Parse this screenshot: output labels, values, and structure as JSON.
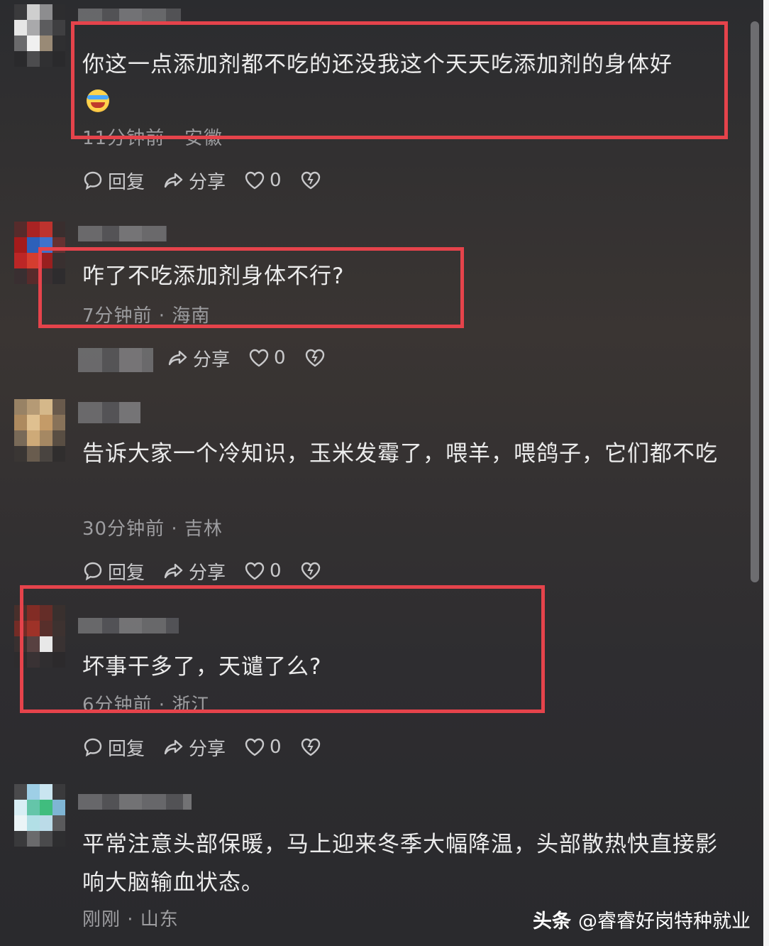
{
  "comments": [
    {
      "text": "你这一点添加剂都不吃的还没我这个天天吃添加剂的身体好",
      "emoji": "crying-laughing-emoji",
      "meta": "11分钟前 · 安徽",
      "reply": "回复",
      "share": "分享",
      "likes": "0"
    },
    {
      "text": "咋了不吃添加剂身体不行?",
      "meta": "7分钟前 · 海南",
      "share": "分享",
      "likes": "0"
    },
    {
      "text": "告诉大家一个冷知识，玉米发霉了，喂羊，喂鸽子，它们都不吃",
      "meta": "30分钟前 · 吉林",
      "reply": "回复",
      "share": "分享",
      "likes": "0"
    },
    {
      "text": "坏事干多了，天谴了么?",
      "meta": "6分钟前 · 浙江",
      "reply": "回复",
      "share": "分享",
      "likes": "0"
    },
    {
      "text": "平常注意头部保暖，马上迎来冬季大幅降温，头部散热快直接影响大脑输血状态。",
      "meta": "刚刚 · 山东"
    }
  ],
  "watermark": {
    "brand": "头条",
    "account": "@睿睿好岗特种就业"
  },
  "colors": {
    "highlight": "#e5434b",
    "background": "#2e2d30",
    "text": "#ececec",
    "meta": "#9d9da0"
  }
}
